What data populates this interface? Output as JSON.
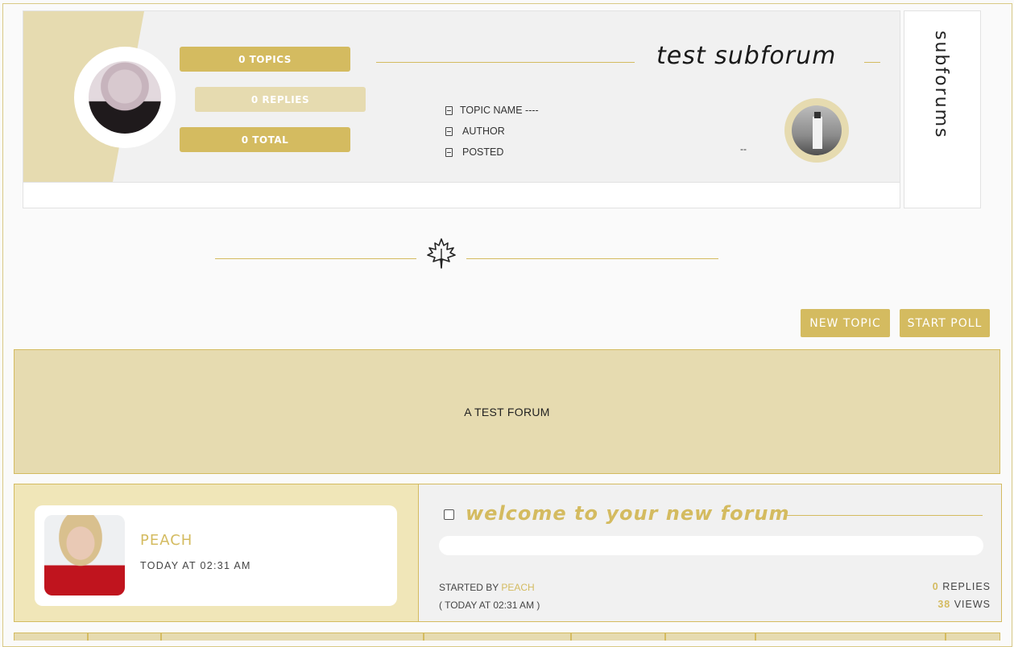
{
  "subforum": {
    "stats": {
      "topics": "0 TOPICS",
      "replies": "0 REPLIES",
      "total": "0 TOTAL"
    },
    "title": "test subforum",
    "last_post": {
      "topic_name": "TOPIC NAME ----",
      "author": "AUTHOR",
      "posted": "POSTED",
      "date": "--"
    },
    "side_label": "subforums"
  },
  "actions": {
    "new_topic": "NEW TOPIC",
    "start_poll": "START POLL"
  },
  "forum_description": "A TEST FORUM",
  "topic": {
    "author_name": "PEACH",
    "author_time": "TODAY AT 02:31 AM",
    "title": "welcome to your new forum",
    "started_by_label": "STARTED BY ",
    "started_by_name": "PEACH",
    "started_time": "( TODAY AT 02:31 AM )",
    "replies_count": "0",
    "replies_label": " REPLIES",
    "views_count": "38",
    "views_label": " VIEWS"
  },
  "colors": {
    "accent": "#d4bb60",
    "accent_light": "#e6dbb0",
    "panel": "#f1f1f1"
  },
  "icons": {
    "divider": "maple-leaf-icon",
    "post_meta": "document-icon"
  }
}
